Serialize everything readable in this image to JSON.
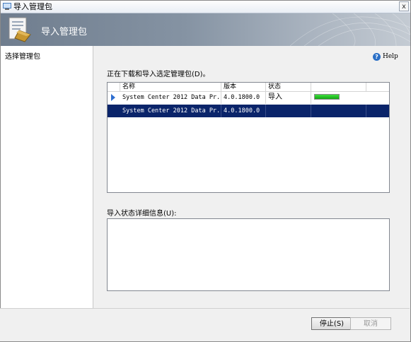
{
  "window": {
    "title": "导入管理包",
    "close_glyph": "x"
  },
  "banner": {
    "title": "导入管理包"
  },
  "nav": {
    "items": [
      {
        "label": "选择管理包"
      }
    ]
  },
  "help": {
    "label": "Help"
  },
  "section_label": "正在下载和导入选定管理包(D)。",
  "table": {
    "columns": [
      "名称",
      "版本",
      "状态",
      ""
    ],
    "rows": [
      {
        "name": "System Center 2012 Data Pr...",
        "version": "4.0.1800.0",
        "status": "导入",
        "progress": 1.0,
        "selected": false
      },
      {
        "name": "System Center 2012 Data Pr...",
        "version": "4.0.1800.0",
        "status": "",
        "progress": null,
        "selected": true
      }
    ]
  },
  "details": {
    "label": "导入状态详细信息(U):",
    "text": ""
  },
  "buttons": {
    "stop": "停止(S)",
    "cancel": "取消"
  },
  "colors": {
    "selection": "#0a246a",
    "progress": "#1fbf1f",
    "banner": "#7a8899"
  }
}
